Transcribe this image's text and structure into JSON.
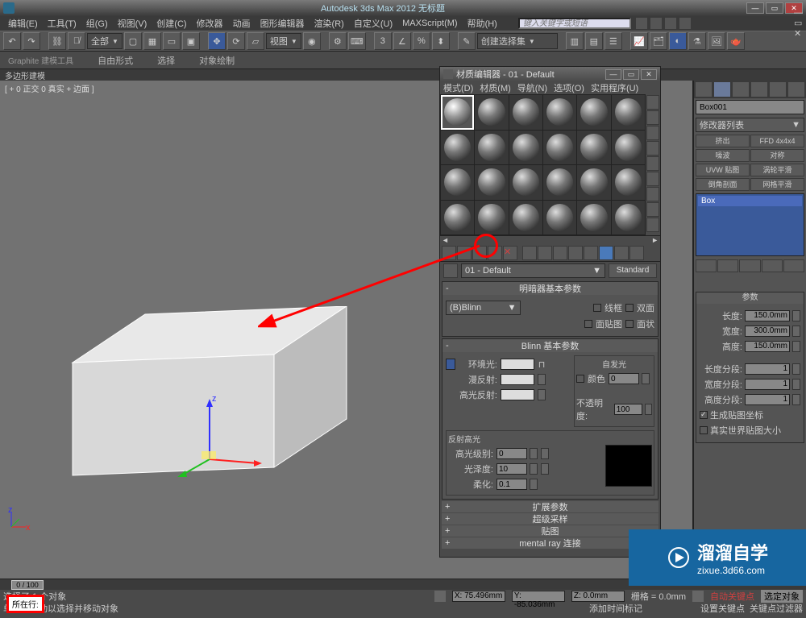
{
  "title": "Autodesk 3ds Max  2012       无标题",
  "search_placeholder": "键入关键字或短语",
  "menubar": [
    "编辑(E)",
    "工具(T)",
    "组(G)",
    "视图(V)",
    "创建(C)",
    "修改器",
    "动画",
    "图形编辑器",
    "渲染(R)",
    "自定义(U)",
    "MAXScript(M)",
    "帮助(H)"
  ],
  "toolbar_drop_all": "全部",
  "toolbar_drop_view": "视图",
  "toolbar_drop_select": "创建选择集",
  "ribbon_label": "Graphite 建模工具",
  "ribbon_tabs": [
    "自由形式",
    "选择",
    "对象绘制"
  ],
  "strip2": "多边形建模",
  "viewport_label": "[ + 0 正交 0 真实 + 边面 ]",
  "material_editor": {
    "title": "材质编辑器 - 01 - Default",
    "menu": [
      "模式(D)",
      "材质(M)",
      "导航(N)",
      "选项(O)",
      "实用程序(U)"
    ],
    "name_drop": "01 - Default",
    "type_btn": "Standard",
    "rollout_shader": "明暗器基本参数",
    "shader_drop": "(B)Blinn",
    "opt_wire": "线框",
    "opt_2side": "双面",
    "opt_facemap": "面贴图",
    "opt_faceted": "面状",
    "rollout_blinn": "Blinn 基本参数",
    "lbl_ambient": "环境光:",
    "lbl_diffuse": "漫反射:",
    "lbl_specular": "高光反射:",
    "selfillum_hdr": "自发光",
    "selfillum_color": "颜色",
    "selfillum_val": "0",
    "opacity_lbl": "不透明度:",
    "opacity_val": "100",
    "spec_hdr": "反射高光",
    "spec_level": "高光级别:",
    "spec_level_val": "0",
    "gloss": "光泽度:",
    "gloss_val": "10",
    "soften": "柔化:",
    "soften_val": "0.1",
    "ro_extended": "扩展参数",
    "ro_supersample": "超级采样",
    "ro_maps": "贴图",
    "ro_mentalray": "mental ray 连接"
  },
  "cmdpanel": {
    "name": "Box001",
    "modlist": "修改器列表",
    "btns": [
      [
        "挤出",
        "FFD 4x4x4"
      ],
      [
        "噪波",
        "对称"
      ],
      [
        "UVW 贴图",
        "涡轮平滑"
      ],
      [
        "倒角剖面",
        "网格平滑"
      ]
    ],
    "stack": "Box",
    "params_hdr": "参数",
    "length": "长度:",
    "length_v": "150.0mm",
    "width": "宽度:",
    "width_v": "300.0mm",
    "height": "高度:",
    "height_v": "150.0mm",
    "lseg": "长度分段:",
    "lseg_v": "1",
    "wseg": "宽度分段:",
    "wseg_v": "1",
    "hseg": "高度分段:",
    "hseg_v": "1",
    "gen_map": "生成贴图坐标",
    "real_world": "真实世界贴图大小"
  },
  "status": {
    "sel": "选择了 1 个对象",
    "hint": "单击并拖动以选择并移动对象",
    "x": "X: 75.496mm",
    "y": "Y: -85.036mm",
    "z": "Z: 0.0mm",
    "grid": "栅格 = 0.0mm",
    "addtime": "添加时间标记",
    "autokey": "自动关键点",
    "selset": "选定对象",
    "setkey": "设置关键点",
    "keyfilter": "关键点过滤器"
  },
  "timeline_handle": "0 / 100",
  "red_box": "所在行:",
  "watermark": {
    "logo": "溜溜自学",
    "url": "zixue.3d66.com"
  }
}
